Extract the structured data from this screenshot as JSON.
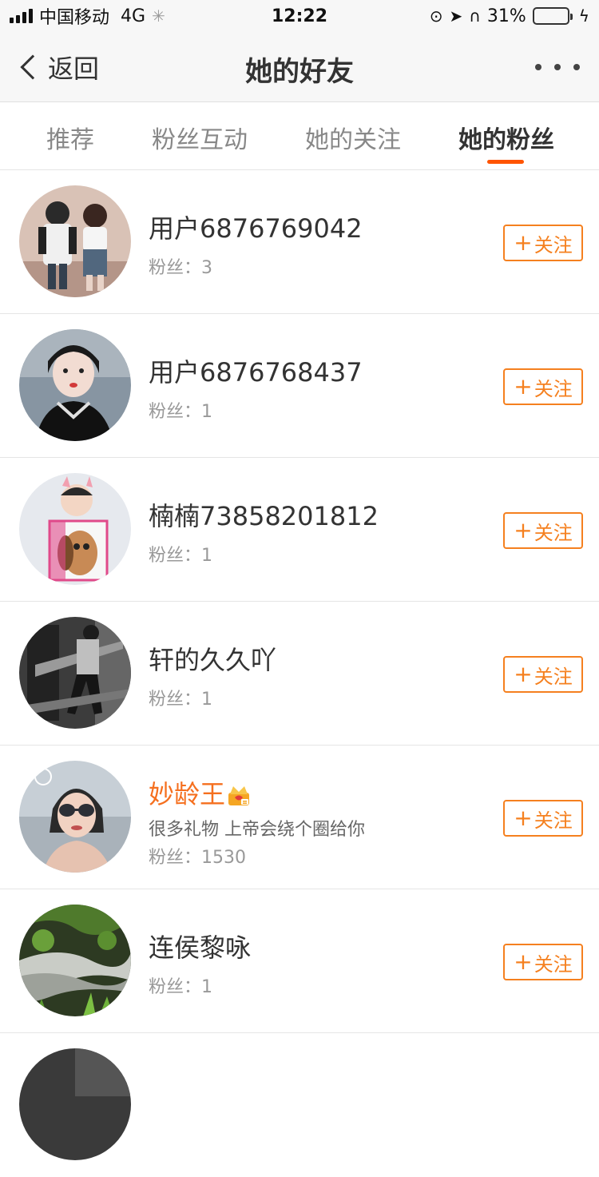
{
  "status_bar": {
    "carrier": "中国移动",
    "network": "4G",
    "time": "12:22",
    "battery_percent": "31%",
    "battery_level": 0.31,
    "icons": [
      "signal-icon",
      "loading-icon",
      "lock-rotation-icon",
      "location-icon",
      "headphones-icon",
      "battery-icon",
      "charging-icon"
    ]
  },
  "nav": {
    "back_label": "返回",
    "title": "她的好友",
    "more_icon": "more-dots-icon"
  },
  "tabs": [
    {
      "label": "推荐",
      "active": false
    },
    {
      "label": "粉丝互动",
      "active": false
    },
    {
      "label": "她的关注",
      "active": false
    },
    {
      "label": "她的粉丝",
      "active": true
    }
  ],
  "accent_color": "#ff5400",
  "follow_color": "#f5801f",
  "users": [
    {
      "name": "用户6876769042",
      "bio": "",
      "fans": "粉丝：3",
      "follow_label": "关注",
      "vip": false
    },
    {
      "name": "用户6876768437",
      "bio": "",
      "fans": "粉丝：1",
      "follow_label": "关注",
      "vip": false
    },
    {
      "name": "楠楠73858201812",
      "bio": "",
      "fans": "粉丝：1",
      "follow_label": "关注",
      "vip": false
    },
    {
      "name": "轩的久久吖",
      "bio": "",
      "fans": "粉丝：1",
      "follow_label": "关注",
      "vip": false
    },
    {
      "name": "妙龄王",
      "bio": "很多礼物 上帝会绕个圈给你",
      "fans": "粉丝：1530",
      "follow_label": "关注",
      "vip": true
    },
    {
      "name": "连侯黎咏",
      "bio": "",
      "fans": "粉丝：1",
      "follow_label": "关注",
      "vip": false
    }
  ]
}
